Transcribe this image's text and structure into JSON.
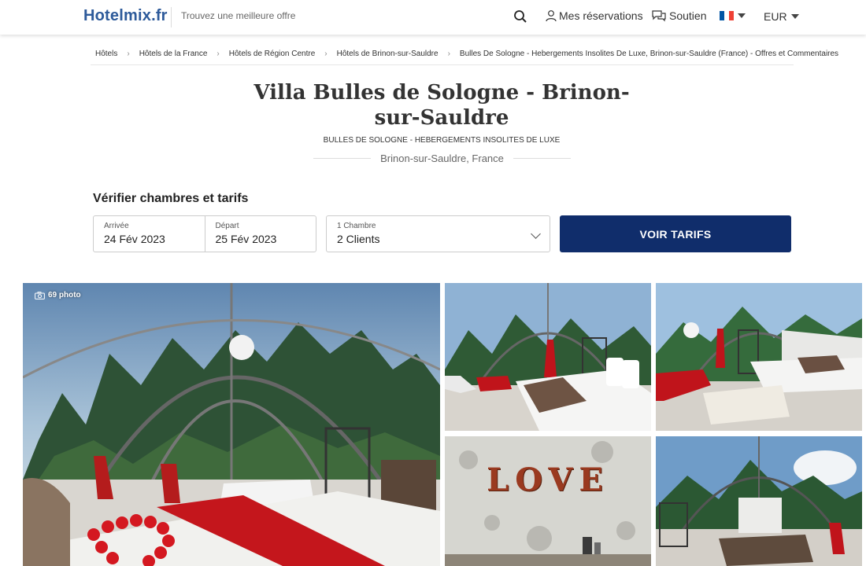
{
  "header": {
    "logo": "Hotelmix.fr",
    "tagline": "Trouvez une meilleure offre",
    "reservations_label": "Mes réservations",
    "support_label": "Soutien",
    "currency": "EUR"
  },
  "breadcrumb": [
    "Hôtels",
    "Hôtels de la France",
    "Hôtels de Région Centre",
    "Hôtels de Brinon-sur-Sauldre",
    "Bulles De Sologne - Hebergements Insolites De Luxe, Brinon-sur-Sauldre (France) - Offres et Commentaires"
  ],
  "hotel": {
    "title": "Villa Bulles de Sologne - Brinon-sur-Sauldre",
    "subtitle": "BULLES DE SOLOGNE - HEBERGEMENTS INSOLITES DE LUXE",
    "location": "Brinon-sur-Sauldre, France"
  },
  "availability": {
    "heading": "Vérifier chambres et tarifs",
    "arrival_label": "Arrivée",
    "arrival_value": "24 Fév 2023",
    "departure_label": "Départ",
    "departure_value": "25 Fév 2023",
    "rooms_label": "1 Chambre",
    "guests_value": "2 Clients",
    "cta_label": "VOIR TARIFS"
  },
  "gallery": {
    "photo_count": "69 photo",
    "love_sign": "LOVE"
  },
  "colors": {
    "brand": "#2d5a9a",
    "cta": "#102d6b"
  }
}
